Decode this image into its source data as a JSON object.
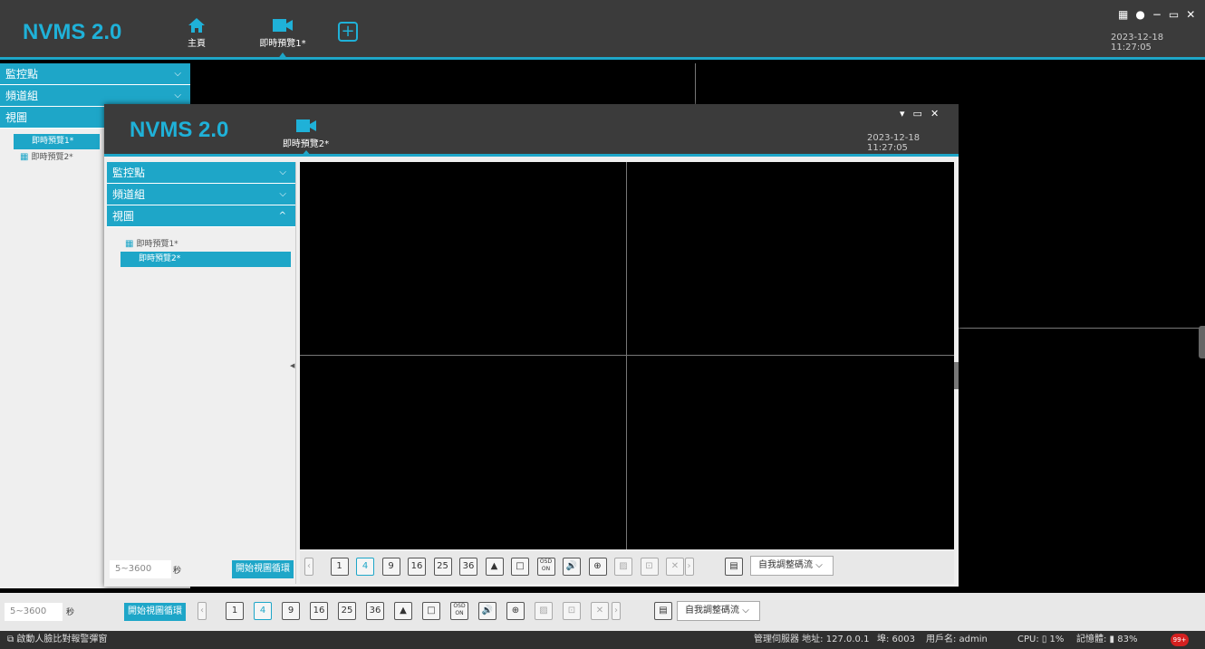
{
  "app": {
    "logo": "NVMS 2.0",
    "datetime": "2023-12-18 11:27:05"
  },
  "main": {
    "tabs": [
      {
        "label": "主頁"
      },
      {
        "label": "即時預覽1*"
      }
    ],
    "sidebar": {
      "sections": [
        {
          "label": "監控點"
        },
        {
          "label": "頻道組"
        },
        {
          "label": "視圖"
        }
      ],
      "views": [
        {
          "label": "即時預覽1*"
        },
        {
          "label": "即時預覽2*"
        }
      ]
    },
    "seconds_placeholder": "5~3600",
    "seconds_unit": "秒",
    "start_cycle": "開始視圖循環",
    "stream_select": "自我調整碼流"
  },
  "inner": {
    "logo": "NVMS 2.0",
    "tab": "即時預覽2*",
    "datetime": "2023-12-18 11:27:05",
    "sidebar": {
      "sections": [
        {
          "label": "監控點"
        },
        {
          "label": "頻道組"
        },
        {
          "label": "視圖"
        }
      ],
      "views": [
        {
          "label": "即時預覽1*"
        },
        {
          "label": "即時預覽2*"
        }
      ]
    },
    "seconds_placeholder": "5~3600",
    "seconds_unit": "秒",
    "start_cycle": "開始視圖循環",
    "stream_select": "自我調整碼流"
  },
  "toolbar": {
    "buttons": [
      "1",
      "4",
      "9",
      "16",
      "25",
      "36",
      "▲",
      "□",
      "OSD ON",
      "🔊",
      "⊕",
      "▨",
      "⊡",
      "✕",
      "›"
    ]
  },
  "status": {
    "face_compare": "啟動人臉比對報警彈窗",
    "server": "管理伺服器 地址: 127.0.0.1",
    "port": "埠: 6003",
    "user": "用戶名: admin",
    "cpu": "CPU: ▯ 1%",
    "memory": "記憶體: ▮ 83%",
    "badge": "99+"
  }
}
